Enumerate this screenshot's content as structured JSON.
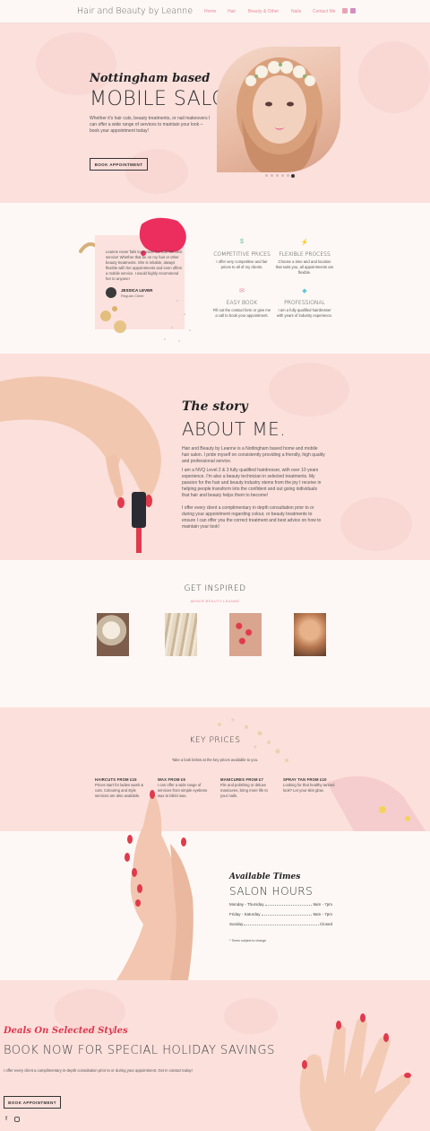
{
  "header": {
    "logo": "Hair and Beauty by Leanne",
    "nav": [
      {
        "label": "Home"
      },
      {
        "label": "Hair"
      },
      {
        "label": "Beauty & Other"
      },
      {
        "label": "Nails"
      },
      {
        "label": "Contact Me"
      }
    ],
    "social_icons": [
      "facebook-icon",
      "instagram-icon"
    ]
  },
  "hero": {
    "subtitle": "Nottingham based",
    "title": "MOBILE SALON",
    "description": "Whether it's hair cuts, beauty treatments, or nail makeovers I can offer a wide range of services to maintain your look – book your appointment today!",
    "button": "BOOK APPOINTMENT",
    "slides": 6,
    "active_slide": 6
  },
  "testimonial": {
    "quote": "Leanne never fails to provide me with the best service! Whether that be on my hair or other beauty treatments. She is reliable, always flexible with her appointments and even offers a mobile service. I would highly recommend her to anyone!",
    "name": "JESSICA LEVER",
    "role": "Regular Client"
  },
  "features": [
    {
      "icon": "dollar-icon",
      "title": "COMPETITIVE PRICES",
      "text": "I offer very competitive and fair prices to all of my clients."
    },
    {
      "icon": "lightning-icon",
      "title": "FLEXIBLE PROCESS",
      "text": "Choose a time and and location that suits you, all appointments are flexible."
    },
    {
      "icon": "envelope-icon",
      "title": "EASY BOOK",
      "text": "Fill out the contact form or give me a call to book your appointment."
    },
    {
      "icon": "diamond-icon",
      "title": "PROFESSIONAL",
      "text": "I am a fully qualified hairdresser with years of industry experience."
    }
  ],
  "story": {
    "subtitle": "The story",
    "title": "ABOUT ME.",
    "paragraphs": [
      "Hair and Beauty by Leanne is a Nottingham based home and mobile hair salon. I pride myself on consistently providing a friendly, high quality and professional service.",
      "I am a NVQ Level 2 & 3 fully qualified hairdresser, with over 10 years experience. I'm also a beauty technician in selected treatments. My passion for the hair and beauty industry stems from the joy I receive in helping people transform into the confident and out going individuals that hair and beauty helps them to become!",
      "I offer every client a complimentary in depth consultation prior to or during your appointment regarding colour, or beauty treatments to ensure I can offer you the correct treatment and best advice on how to maintain your look!"
    ]
  },
  "inspired": {
    "title": "GET INSPIRED",
    "handle": "@HAIR.BEAUTY.LEANNE"
  },
  "prices": {
    "title": "KEY PRICES",
    "intro": "Take a look below at the key prices available to you.",
    "items": [
      {
        "title": "HAIRCUTS FROM £15",
        "text": "Prices start for ladies wash & cuts. Colouring and style services are also available."
      },
      {
        "title": "WAX FROM £5",
        "text": "I can offer a wide range of services from simple eyebrow wax to bikini wax."
      },
      {
        "title": "MANICURES FROM £7",
        "text": "File and polishing or deluxe manicures, bring more life to your nails."
      },
      {
        "title": "SPRAY TAN FROM £10",
        "text": "Looking for that healthy tanned look? Let your skin glow."
      }
    ]
  },
  "hours": {
    "subtitle": "Available Times",
    "title": "SALON HOURS",
    "rows": [
      {
        "day": "Monday - Thursday",
        "time": "9am - 7pm"
      },
      {
        "day": "Friday - Saturday",
        "time": "9am - 7pm"
      },
      {
        "day": "Sunday",
        "time": "Closed"
      }
    ],
    "note": "* Times subject to change"
  },
  "deals": {
    "subtitle": "Deals On Selected Styles",
    "title": "BOOK NOW FOR SPECIAL HOLIDAY SAVINGS",
    "text": "I offer every client a complimentary in-depth consultation prior to or during your appointment. Get in contact today!",
    "button": "BOOK APPOINTMENT",
    "footer_icons": [
      "facebook-icon",
      "instagram-icon"
    ]
  },
  "colors": {
    "accent": "#e88a9a",
    "pink_bg": "#fbe0dc",
    "cream_bg": "#fdf8f5",
    "script_red": "#e0384f"
  }
}
